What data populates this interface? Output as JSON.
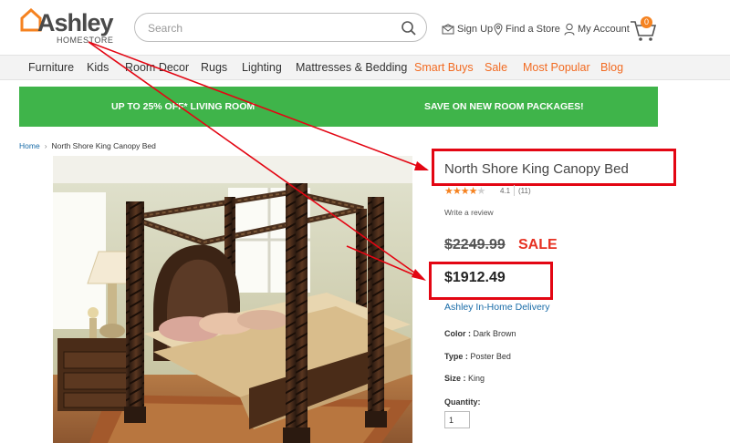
{
  "header": {
    "logo_text": "Ashley",
    "logo_subtext": "HOMESTORE",
    "search_placeholder": "Search",
    "sign_up": "Sign Up",
    "find_store": "Find a Store",
    "my_account": "My Account",
    "cart_count": "0"
  },
  "nav": [
    {
      "label": "Furniture"
    },
    {
      "label": "Kids"
    },
    {
      "label": "Room Decor"
    },
    {
      "label": "Rugs"
    },
    {
      "label": "Lighting"
    },
    {
      "label": "Mattresses & Bedding"
    },
    {
      "label": "Smart Buys"
    },
    {
      "label": "Sale"
    },
    {
      "label": "Most Popular"
    },
    {
      "label": "Blog"
    }
  ],
  "promo": {
    "left": "UP TO 25% OFF* LIVING ROOM",
    "right": "SAVE ON NEW ROOM PACKAGES!"
  },
  "breadcrumb": {
    "home": "Home",
    "separator": "›",
    "current": "North Shore King Canopy Bed"
  },
  "product": {
    "title": "North Shore King Canopy Bed",
    "rating": 4.1,
    "rating_label": "4.1",
    "review_count": "(11)",
    "write_review": "Write a review",
    "old_price": "$2249.99",
    "sale_label": "SALE",
    "price": "$1912.49",
    "delivery": "Ashley In-Home Delivery",
    "color_label": "Color :",
    "color_value": "Dark Brown",
    "type_label": "Type :",
    "type_value": "Poster Bed",
    "size_label": "Size :",
    "size_value": "King",
    "quantity_label": "Quantity:",
    "quantity_value": "1"
  },
  "colors": {
    "promo_green": "#3fb44a",
    "accent_orange": "#f26b22",
    "sale_red": "#e63122",
    "annotation_red": "#e30613",
    "link_blue": "#1a6ca8"
  }
}
